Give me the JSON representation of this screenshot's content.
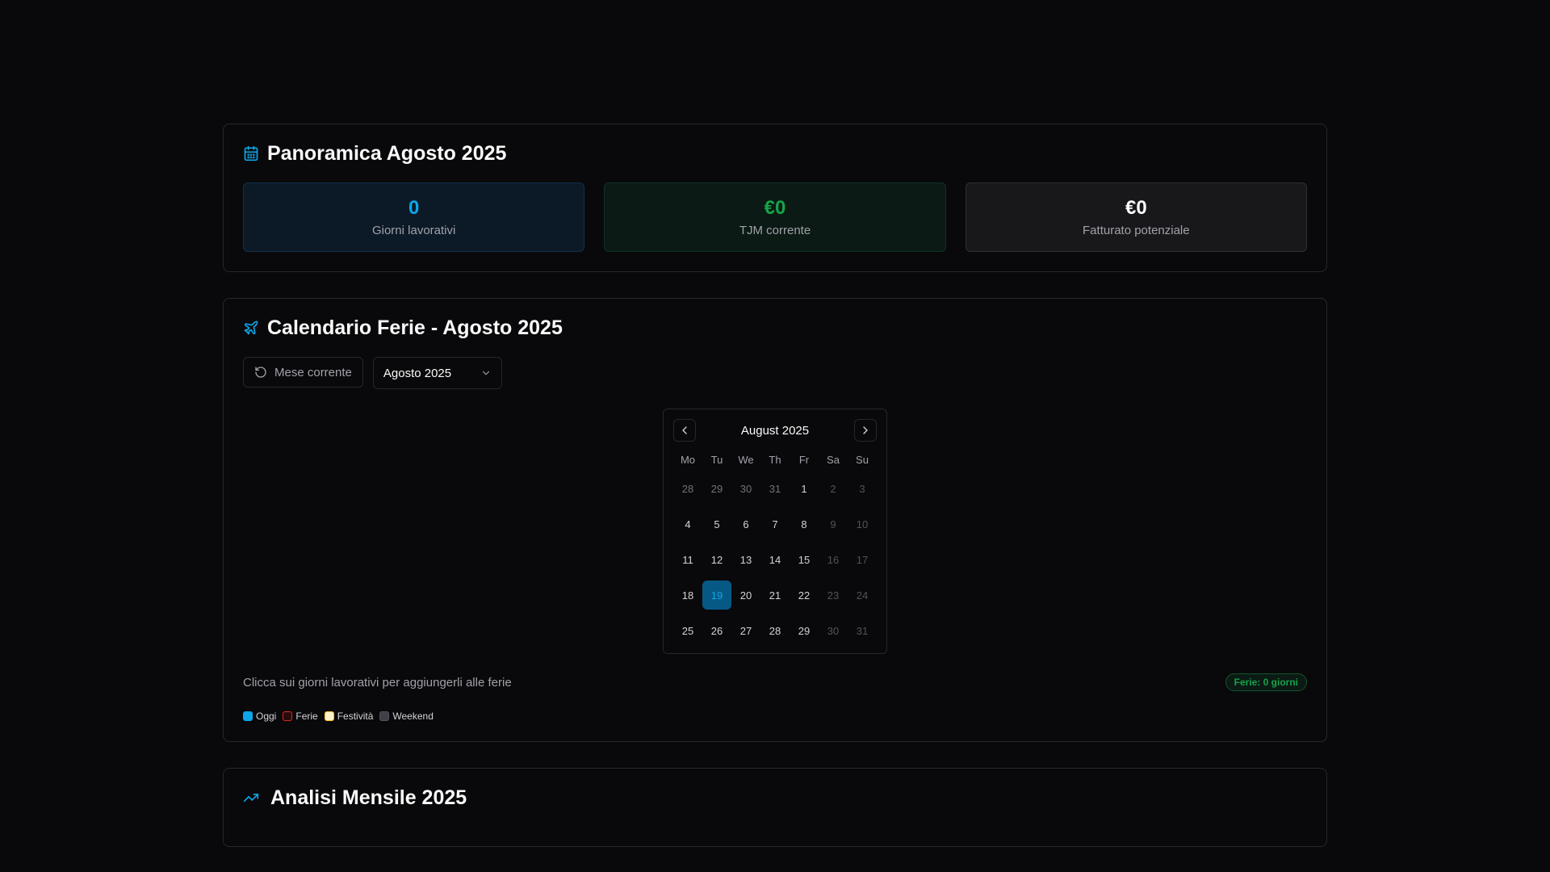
{
  "overview": {
    "title": "Panoramica Agosto 2025",
    "stats": [
      {
        "value": "0",
        "label": "Giorni lavorativi"
      },
      {
        "value": "€0",
        "label": "TJM corrente"
      },
      {
        "value": "€0",
        "label": "Fatturato potenziale"
      }
    ]
  },
  "calendar_section": {
    "title": "Calendario Ferie - Agosto 2025",
    "current_month_button": "Mese corrente",
    "month_select": "Agosto 2025",
    "calendar": {
      "month_label": "August 2025",
      "weekdays": [
        "Mo",
        "Tu",
        "We",
        "Th",
        "Fr",
        "Sa",
        "Su"
      ],
      "weeks": [
        [
          "28",
          "29",
          "30",
          "31",
          "1",
          "2",
          "3"
        ],
        [
          "4",
          "5",
          "6",
          "7",
          "8",
          "9",
          "10"
        ],
        [
          "11",
          "12",
          "13",
          "14",
          "15",
          "16",
          "17"
        ],
        [
          "18",
          "19",
          "20",
          "21",
          "22",
          "23",
          "24"
        ],
        [
          "25",
          "26",
          "27",
          "28",
          "29",
          "30",
          "31"
        ]
      ],
      "today": "19"
    },
    "hint": "Clicca sui giorni lavorativi per aggiungerli alle ferie",
    "badge": "Ferie: 0 giorni",
    "legend": [
      "Oggi",
      "Ferie",
      "Festività",
      "Weekend"
    ]
  },
  "analysis": {
    "title": "Analisi Mensile 2025"
  },
  "colors": {
    "accent_blue": "#0ea5e9",
    "accent_green": "#16a34a",
    "background": "#09090b"
  }
}
